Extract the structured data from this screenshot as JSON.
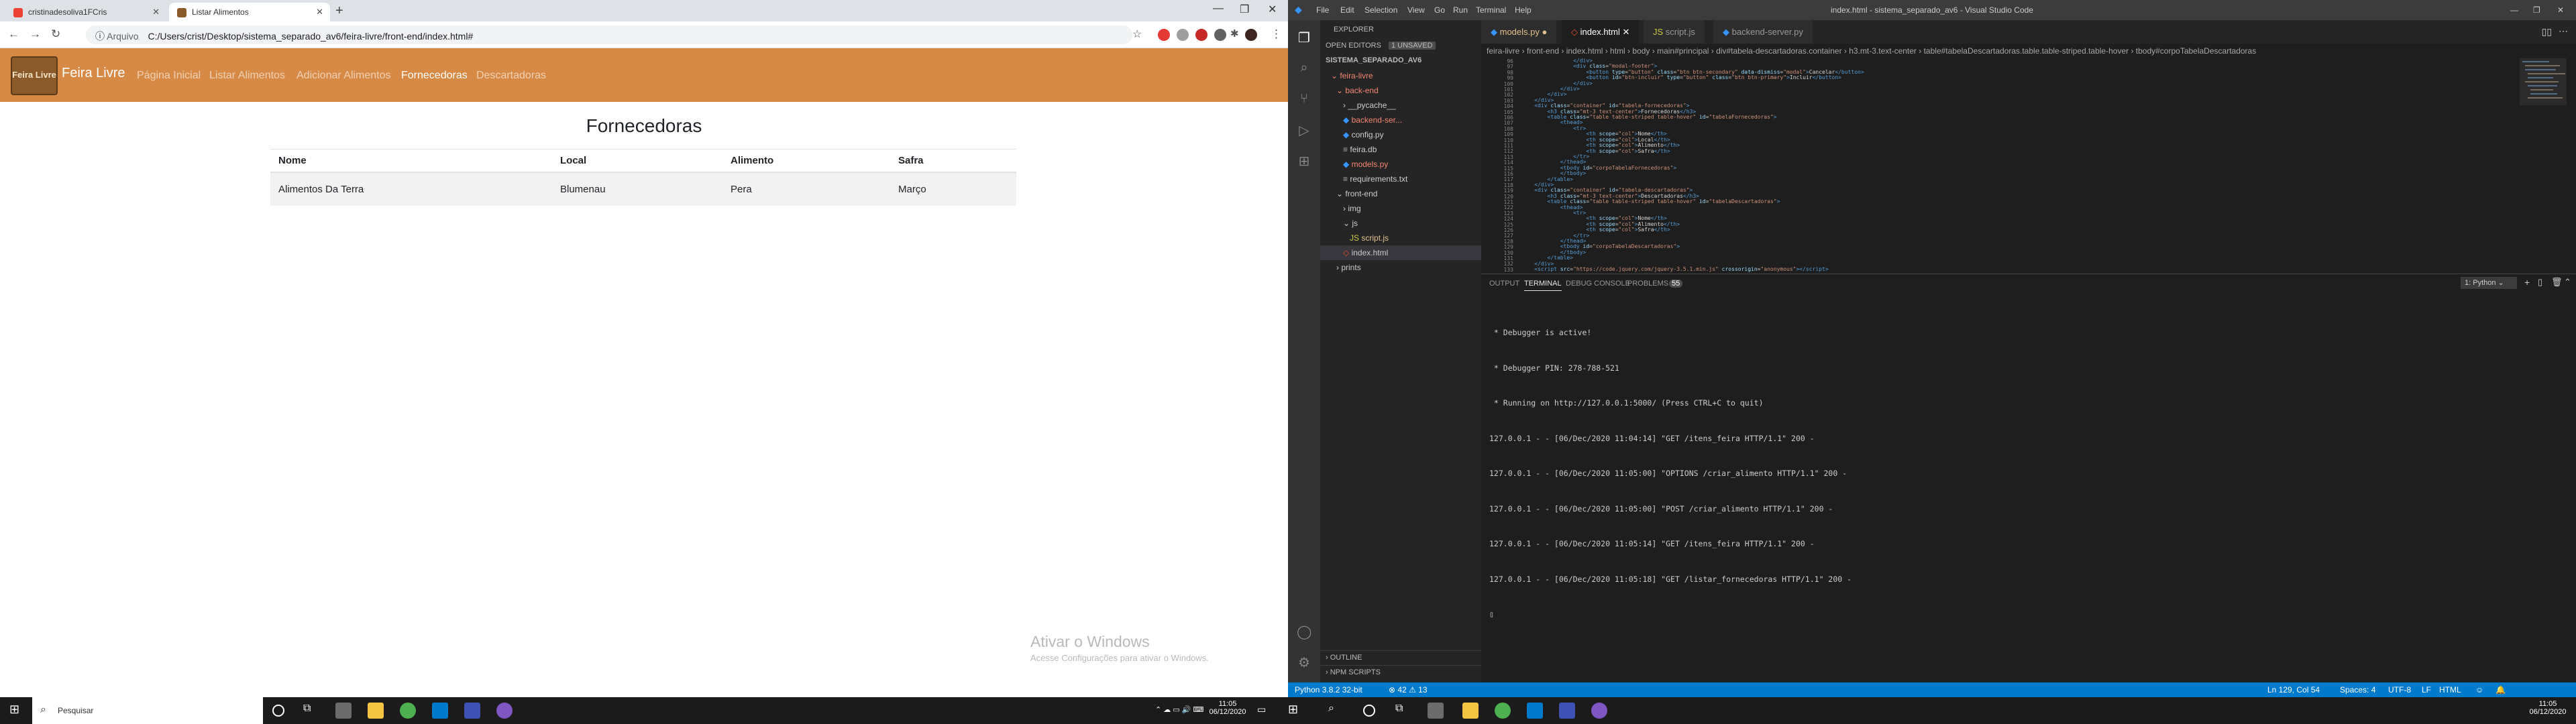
{
  "browser": {
    "tabs": [
      {
        "title": "cristinadesoliva1FCris"
      },
      {
        "title": "Listar Alimentos"
      }
    ],
    "url_label": "Arquivo",
    "url": "C:/Users/crist/Desktop/sistema_separado_av6/feira-livre/front-end/index.html#"
  },
  "site": {
    "brand": "Feira Livre",
    "logo_text": "Feira Livre",
    "nav": [
      "Página Inicial",
      "Listar Alimentos",
      "Adicionar Alimentos",
      "Fornecedoras",
      "Descartadoras"
    ],
    "active_nav": "Fornecedoras",
    "heading": "Fornecedoras",
    "table": {
      "headers": [
        "Nome",
        "Local",
        "Alimento",
        "Safra"
      ],
      "rows": [
        [
          "Alimentos Da Terra",
          "Blumenau",
          "Pera",
          "Março"
        ]
      ]
    },
    "watermark_title": "Ativar o Windows",
    "watermark_sub": "Acesse Configurações para ativar o Windows."
  },
  "vscode": {
    "menu": [
      "File",
      "Edit",
      "Selection",
      "View",
      "Go",
      "Run",
      "Terminal",
      "Help"
    ],
    "title": "index.html - sistema_separado_av6 - Visual Studio Code",
    "explorer": {
      "title": "EXPLORER",
      "open_editors": "OPEN EDITORS",
      "unsaved": "1 UNSAVED",
      "root": "SISTEMA_SEPARADO_AV6",
      "items": [
        "feira-livre",
        "back-end",
        "__pycache__",
        "backend-ser...",
        "config.py",
        "feira.db",
        "models.py",
        "requirements.txt",
        "front-end",
        "img",
        "js",
        "script.js",
        "index.html",
        "prints"
      ],
      "outline": "OUTLINE",
      "npm": "NPM SCRIPTS"
    },
    "tabs": [
      "models.py",
      "index.html",
      "script.js",
      "backend-server.py"
    ],
    "breadcrumbs": "feira-livre › front-end › index.html › html › body › main#principal › div#tabela-descartadoras.container › h3.mt-3.text-center › table#tabelaDescartadoras.table.table-striped.table-hover › tbody#corpoTabelaDescartadoras",
    "line_numbers": [
      "96",
      "97",
      "98",
      "99",
      "100",
      "101",
      "102",
      "103",
      "104",
      "105",
      "106",
      "107",
      "108",
      "109",
      "110",
      "111",
      "112",
      "113",
      "114",
      "115",
      "116",
      "117",
      "118",
      "119",
      "120",
      "121",
      "122",
      "123",
      "124",
      "125",
      "126",
      "127",
      "128",
      "129",
      "130",
      "131",
      "132",
      "133"
    ],
    "panel_tabs": [
      "OUTPUT",
      "TERMINAL",
      "DEBUG CONSOLE",
      "PROBLEMS",
      "55"
    ],
    "terminal_select": "1: Python",
    "terminal": [
      " * Debugger is active!",
      " * Debugger PIN: 278-788-521",
      " * Running on http://127.0.0.1:5000/ (Press CTRL+C to quit)",
      "127.0.0.1 - - [06/Dec/2020 11:04:14] \"GET /itens_feira HTTP/1.1\" 200 -",
      "127.0.0.1 - - [06/Dec/2020 11:05:00] \"OPTIONS /criar_alimento HTTP/1.1\" 200 -",
      "127.0.0.1 - - [06/Dec/2020 11:05:00] \"POST /criar_alimento HTTP/1.1\" 200 -",
      "127.0.0.1 - - [06/Dec/2020 11:05:14] \"GET /itens_feira HTTP/1.1\" 200 -",
      "127.0.0.1 - - [06/Dec/2020 11:05:18] \"GET /listar_fornecedoras HTTP/1.1\" 200 -"
    ],
    "status": {
      "python": "Python 3.8.2 32-bit",
      "errors": "⊗ 42 ⚠ 13",
      "position": "Ln 129, Col 54",
      "spaces": "Spaces: 4",
      "encoding": "UTF-8",
      "eol": "LF",
      "lang": "HTML"
    }
  },
  "taskbar": {
    "search": "Pesquisar",
    "time": "11:05",
    "date": "06/12/2020",
    "time2": "11:05",
    "date2": "06/12/2020"
  }
}
